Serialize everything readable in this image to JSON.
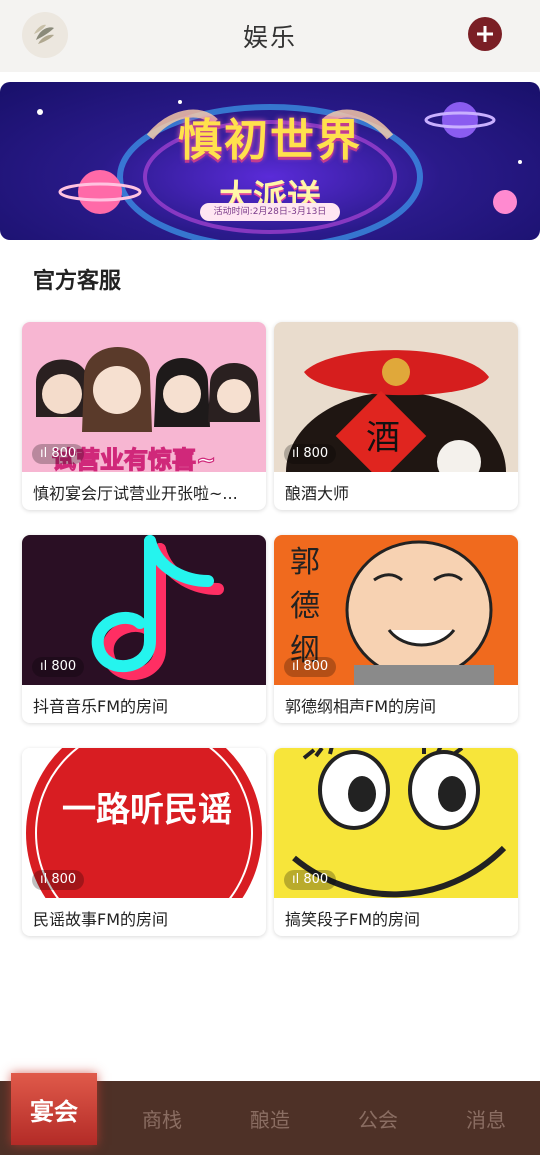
{
  "header": {
    "title": "娱乐",
    "logo_icon": "leaf-logo-icon",
    "add_icon": "plus-icon"
  },
  "banner": {
    "line1": "慎初世界",
    "line2": "大派送",
    "date": "活动时间:2月28日-3月13日"
  },
  "section": {
    "title": "官方客服"
  },
  "rooms": [
    {
      "name": "慎初宴会厅试营业开张啦~...",
      "count": "800",
      "thumb_text": "试营业有惊喜~"
    },
    {
      "name": "酿酒大师",
      "count": "800",
      "thumb_text": "酒"
    },
    {
      "name": "抖音音乐FM的房间",
      "count": "800",
      "thumb_text": ""
    },
    {
      "name": "郭德纲相声FM的房间",
      "count": "800",
      "thumb_text": "郭德纲"
    },
    {
      "name": "民谣故事FM的房间",
      "count": "800",
      "thumb_text": "一路听民谣"
    },
    {
      "name": "搞笑段子FM的房间",
      "count": "800",
      "thumb_text": ""
    }
  ],
  "nav": {
    "items": [
      "宴会",
      "商栈",
      "酿造",
      "公会",
      "消息"
    ],
    "active": "宴会"
  },
  "colors": {
    "accent": "#7a1f25",
    "nav_bg": "#4e3127",
    "nav_active": "#c23a32"
  }
}
